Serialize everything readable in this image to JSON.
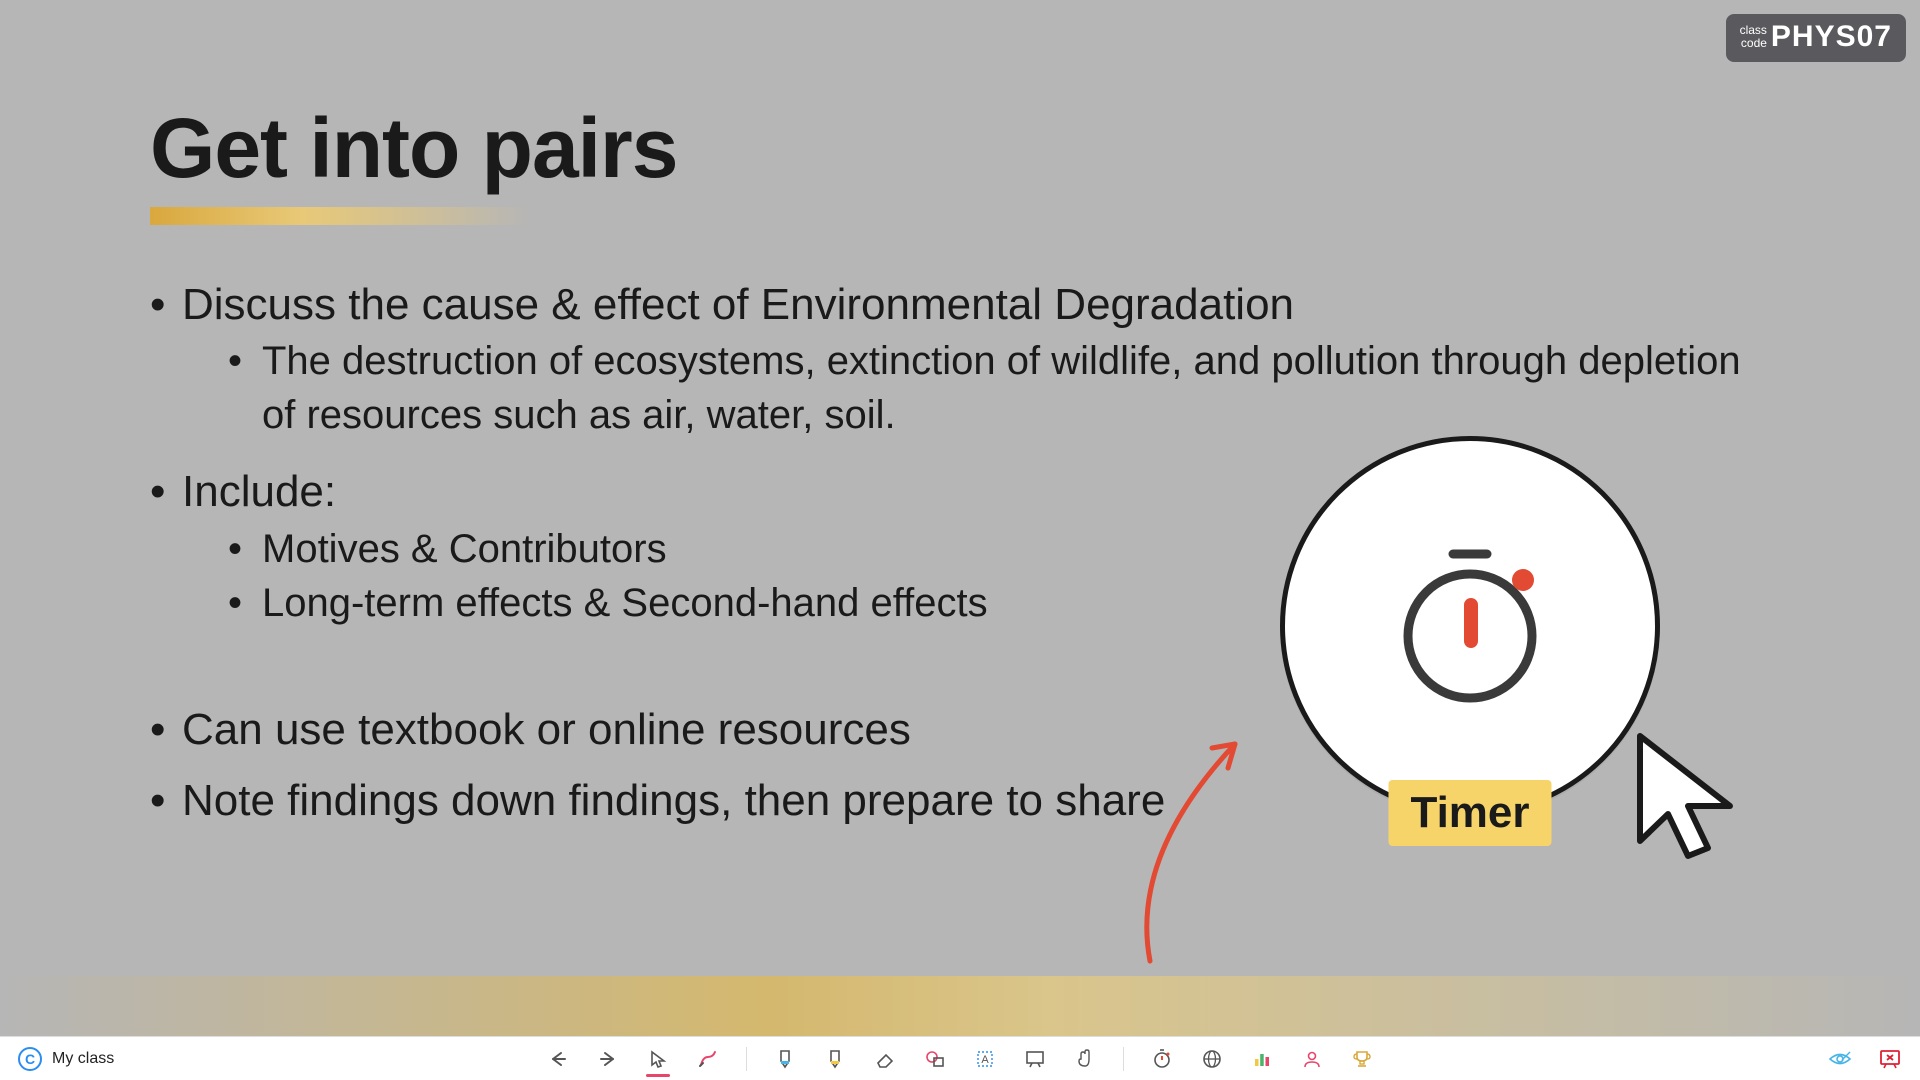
{
  "classCode": {
    "label": "class\ncode",
    "code": "PHYS07"
  },
  "title": "Get into pairs",
  "bullets": {
    "b1": "Discuss the cause & effect of Environmental Degradation",
    "b1a": "The destruction of ecosystems, extinction of wildlife, and pollution through depletion of resources such as air, water, soil.",
    "b2": "Include:",
    "b2a": "Motives & Contributors",
    "b2b": "Long-term effects & Second-hand effects",
    "b3": "Can use textbook or online resources",
    "b4": "Note findings down findings, then prepare to share"
  },
  "timerLabel": "Timer",
  "toolbar": {
    "myClass": "My class",
    "logoLetter": "C"
  }
}
